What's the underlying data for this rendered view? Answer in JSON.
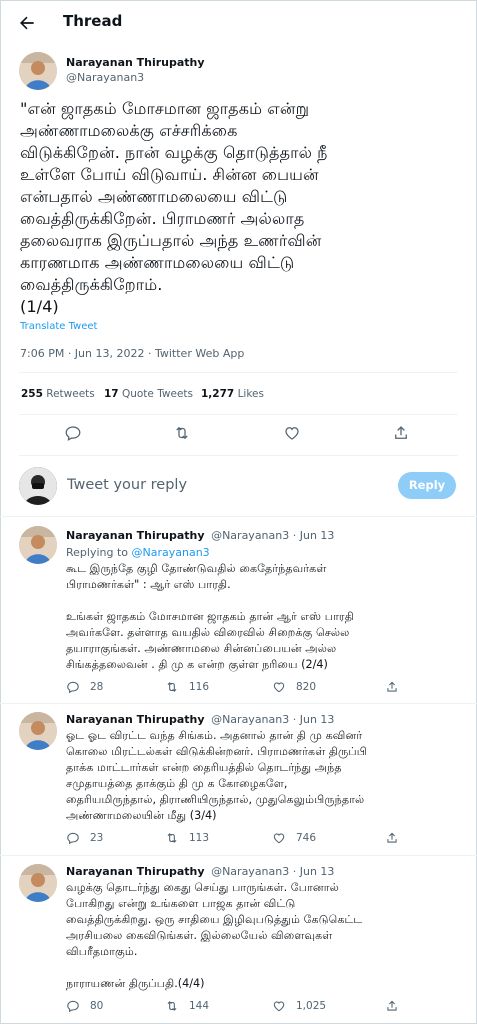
{
  "header": {
    "title": "Thread"
  },
  "main_tweet": {
    "name": "Narayanan Thirupathy",
    "handle": "@Narayanan3",
    "text": "\"என் ஜாதகம் மோசமான ஜாதகம் என்று\nஅண்ணாமலைக்கு எச்சரிக்கை\nவிடுக்கிறேன். நான் வழக்கு தொடுத்தால் நீ\nஉள்ளே போய் விடுவாய். சின்ன பையன்\nஎன்பதால் அண்ணாமலையை விட்டு\nவைத்திருக்கிறேன். பிராமணர் அல்லாத\nதலைவராக இருப்பதால் அந்த உணர்வின்\nகாரணமாக அண்ணாமலையை விட்டு\nவைத்திருக்கிறோம்.\n(1/4)",
    "translate": "Translate Tweet",
    "timestamp": "7:06 PM · Jun 13, 2022 · Twitter Web App",
    "retweets_count": "255",
    "retweets_label": "Retweets",
    "quotes_count": "17",
    "quotes_label": "Quote Tweets",
    "likes_count": "1,277",
    "likes_label": "Likes"
  },
  "reply_box": {
    "placeholder": "Tweet your reply",
    "button": "Reply"
  },
  "replies": [
    {
      "name": "Narayanan Thirupathy",
      "meta": "@Narayanan3 · Jun 13",
      "replying_prefix": "Replying to",
      "replying_to": "@Narayanan3",
      "text": "கூட இருந்தே குழி தோண்டுவதில் கைதேர்ந்தவர்கள்\nபிராமணர்கள்\" : ஆர் எஸ் பாரதி.\n\nஉங்கள் ஜாதகம் மோசமான ஜாதகம் தான் ஆர் எஸ் பாரதி\nஅவர்களே. தள்ளாத வயதில் விரைவில் சிறைக்கு செல்ல\nதயாராகுங்கள். அண்ணாமலை சின்னப்பையன் அல்ல\nசிங்கத்தலைவன் . தி மு க என்ற குள்ள நரியை (2/4)",
      "replies": "28",
      "retweets": "116",
      "likes": "820"
    },
    {
      "name": "Narayanan Thirupathy",
      "meta": "@Narayanan3 · Jun 13",
      "text": "ஓட ஓட விரட்ட வந்த சிங்கம். அதனால் தான் தி மு கவினர்\nகொலை மிரட்டல்கள் விடுக்கின்றனர். பிராமணர்கள் திருப்பி\nதாக்க மாட்டார்கள் என்ற தைரியத்தில் தொடர்ந்து அந்த\nசமுதாயத்தை தாக்கும் தி மு க கோழைகளே,\nதைரியமிருந்தால், திராணியிருந்தால், முதுகெலும்பிருந்தால்\nஅண்ணாமலையின் மீது (3/4)",
      "replies": "23",
      "retweets": "113",
      "likes": "746"
    },
    {
      "name": "Narayanan Thirupathy",
      "meta": "@Narayanan3 · Jun 13",
      "text": "வழக்கு தொடர்ந்து கைது செய்து பாருங்கள். போனால்\nபோகிறது என்று உங்களை பாஜக தான் விட்டு\nவைத்திருக்கிறது. ஒரு சாதியை இழிவுபடுத்தும் கேடுகெட்ட\nஅரசியலை கைவிடுங்கள். இல்லையேல் விளைவுகள்\nவிபரீதமாகும்.\n\nநாராயணன் திருப்பதி.(4/4)",
      "replies": "80",
      "retweets": "144",
      "likes": "1,025"
    }
  ],
  "colors": {
    "accent": "#1d9bf0",
    "reply_button": "#8ecdf8",
    "muted": "#536471",
    "divider": "#eff3f4"
  },
  "icons": [
    "back-arrow-icon",
    "reply-icon",
    "retweet-icon",
    "like-icon",
    "share-icon"
  ]
}
